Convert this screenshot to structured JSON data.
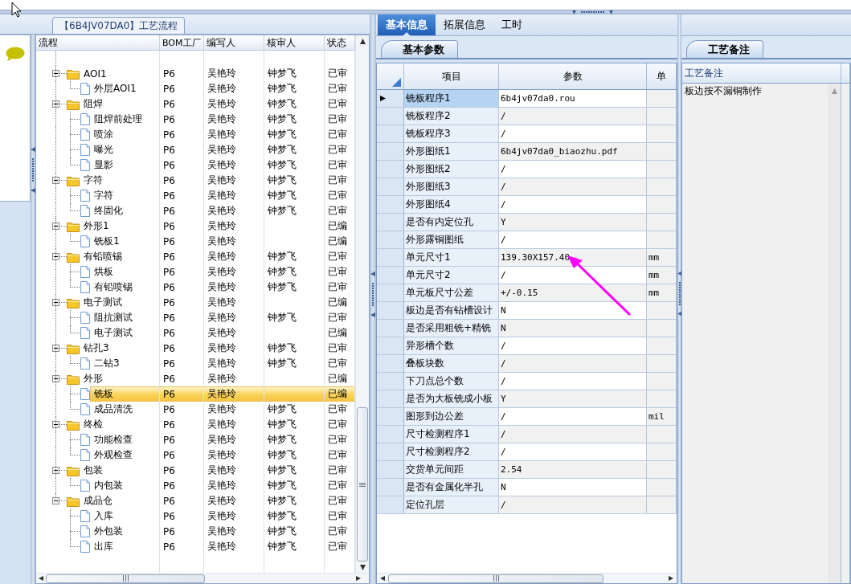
{
  "flow_panel": {
    "title": "【6B4JV07DA0】工艺流程",
    "columns": [
      "流程",
      "BOM工厂",
      "编写人",
      "核审人",
      "状态"
    ],
    "rows": [
      {
        "name": "AOI1",
        "factory": "P6",
        "writer": "吴艳玲",
        "reviewer": "钟梦飞",
        "status": "已审",
        "selected": false,
        "expanded": true,
        "children": [
          {
            "name": "外层AOI1",
            "factory": "P6",
            "writer": "吴艳玲",
            "reviewer": "钟梦飞",
            "status": "已审",
            "selected": false
          }
        ]
      },
      {
        "name": "阻焊",
        "factory": "P6",
        "writer": "吴艳玲",
        "reviewer": "钟梦飞",
        "status": "已审",
        "selected": false,
        "expanded": true,
        "children": [
          {
            "name": "阻焊前处理",
            "factory": "P6",
            "writer": "吴艳玲",
            "reviewer": "钟梦飞",
            "status": "已审",
            "selected": false
          },
          {
            "name": "喷涂",
            "factory": "P6",
            "writer": "吴艳玲",
            "reviewer": "钟梦飞",
            "status": "已审",
            "selected": false
          },
          {
            "name": "曝光",
            "factory": "P6",
            "writer": "吴艳玲",
            "reviewer": "钟梦飞",
            "status": "已审",
            "selected": false
          },
          {
            "name": "显影",
            "factory": "P6",
            "writer": "吴艳玲",
            "reviewer": "钟梦飞",
            "status": "已审",
            "selected": false
          }
        ]
      },
      {
        "name": "字符",
        "factory": "P6",
        "writer": "吴艳玲",
        "reviewer": "钟梦飞",
        "status": "已审",
        "selected": false,
        "expanded": true,
        "children": [
          {
            "name": "字符",
            "factory": "P6",
            "writer": "吴艳玲",
            "reviewer": "钟梦飞",
            "status": "已审",
            "selected": false
          },
          {
            "name": "终固化",
            "factory": "P6",
            "writer": "吴艳玲",
            "reviewer": "钟梦飞",
            "status": "已审",
            "selected": false
          }
        ]
      },
      {
        "name": "外形1",
        "factory": "P6",
        "writer": "吴艳玲",
        "status": "已编",
        "selected": false,
        "expanded": true,
        "children": [
          {
            "name": "铣板1",
            "factory": "P6",
            "writer": "吴艳玲",
            "status": "已编",
            "selected": false
          }
        ]
      },
      {
        "name": "有铅喷锡",
        "factory": "P6",
        "writer": "吴艳玲",
        "reviewer": "钟梦飞",
        "status": "已审",
        "selected": false,
        "expanded": true,
        "children": [
          {
            "name": "烘板",
            "factory": "P6",
            "writer": "吴艳玲",
            "reviewer": "钟梦飞",
            "status": "已审",
            "selected": false
          },
          {
            "name": "有铅喷锡",
            "factory": "P6",
            "writer": "吴艳玲",
            "reviewer": "钟梦飞",
            "status": "已审",
            "selected": false
          }
        ]
      },
      {
        "name": "电子测试",
        "factory": "P6",
        "writer": "吴艳玲",
        "status": "已编",
        "selected": false,
        "expanded": true,
        "children": [
          {
            "name": "阻抗测试",
            "factory": "P6",
            "writer": "吴艳玲",
            "reviewer": "钟梦飞",
            "status": "已审",
            "selected": false
          },
          {
            "name": "电子测试",
            "factory": "P6",
            "writer": "吴艳玲",
            "status": "已编",
            "selected": false
          }
        ]
      },
      {
        "name": "钻孔3",
        "factory": "P6",
        "writer": "吴艳玲",
        "reviewer": "钟梦飞",
        "status": "已审",
        "selected": false,
        "expanded": true,
        "children": [
          {
            "name": "二钻3",
            "factory": "P6",
            "writer": "吴艳玲",
            "reviewer": "钟梦飞",
            "status": "已审",
            "selected": false
          }
        ]
      },
      {
        "name": "外形",
        "factory": "P6",
        "writer": "吴艳玲",
        "status": "已编",
        "selected": false,
        "expanded": true,
        "children": [
          {
            "name": "铣板",
            "factory": "P6",
            "writer": "吴艳玲",
            "status": "已编",
            "selected": true
          },
          {
            "name": "成品清洗",
            "factory": "P6",
            "writer": "吴艳玲",
            "reviewer": "钟梦飞",
            "status": "已审",
            "selected": false
          }
        ]
      },
      {
        "name": "终检",
        "factory": "P6",
        "writer": "吴艳玲",
        "reviewer": "钟梦飞",
        "status": "已审",
        "selected": false,
        "expanded": true,
        "children": [
          {
            "name": "功能检查",
            "factory": "P6",
            "writer": "吴艳玲",
            "reviewer": "钟梦飞",
            "status": "已审",
            "selected": false
          },
          {
            "name": "外观检查",
            "factory": "P6",
            "writer": "吴艳玲",
            "reviewer": "钟梦飞",
            "status": "已审",
            "selected": false
          }
        ]
      },
      {
        "name": "包装",
        "factory": "P6",
        "writer": "吴艳玲",
        "reviewer": "钟梦飞",
        "status": "已审",
        "selected": false,
        "expanded": true,
        "children": [
          {
            "name": "内包装",
            "factory": "P6",
            "writer": "吴艳玲",
            "reviewer": "钟梦飞",
            "status": "已审",
            "selected": false
          }
        ]
      },
      {
        "name": "成品仓",
        "factory": "P6",
        "writer": "吴艳玲",
        "reviewer": "钟梦飞",
        "status": "已审",
        "selected": false,
        "expanded": true,
        "children": [
          {
            "name": "入库",
            "factory": "P6",
            "writer": "吴艳玲",
            "reviewer": "钟梦飞",
            "status": "已审",
            "selected": false
          },
          {
            "name": "外包装",
            "factory": "P6",
            "writer": "吴艳玲",
            "reviewer": "钟梦飞",
            "status": "已审",
            "selected": false
          },
          {
            "name": "出库",
            "factory": "P6",
            "writer": "吴艳玲",
            "reviewer": "钟梦飞",
            "status": "已审",
            "selected": false
          }
        ]
      }
    ]
  },
  "detail_panel": {
    "tabs": [
      {
        "label": "基本信息",
        "selected": true
      },
      {
        "label": "拓展信息",
        "selected": false
      },
      {
        "label": "工时",
        "selected": false
      }
    ],
    "subtab": "基本参数",
    "columns": [
      "项目",
      "参数",
      "单"
    ],
    "rows": [
      {
        "item": "铣板程序1",
        "value": "6b4jv07da0.rou",
        "selected": true
      },
      {
        "item": "铣板程序2",
        "value": "/",
        "selected": false
      },
      {
        "item": "铣板程序3",
        "value": "/",
        "selected": false
      },
      {
        "item": "外形图纸1",
        "value": "6b4jv07da0_biaozhu.pdf",
        "selected": false
      },
      {
        "item": "外形图纸2",
        "value": "/",
        "selected": false
      },
      {
        "item": "外形图纸3",
        "value": "/",
        "selected": false
      },
      {
        "item": "外形图纸4",
        "value": "/",
        "selected": false
      },
      {
        "item": "是否有内定位孔",
        "value": "Y",
        "selected": false
      },
      {
        "item": "外形露铜图纸",
        "value": "/",
        "selected": false
      },
      {
        "item": "单元尺寸1",
        "value": "139.30X157.40",
        "unit": "mm",
        "selected": false
      },
      {
        "item": "单元尺寸2",
        "value": "/",
        "unit": "mm",
        "selected": false
      },
      {
        "item": "单元板尺寸公差",
        "value": "+/-0.15",
        "unit": "mm",
        "selected": false
      },
      {
        "item": "板边是否有钻槽设计",
        "value": "N",
        "selected": false
      },
      {
        "item": "是否采用粗铣+精铣",
        "value": "N",
        "selected": false
      },
      {
        "item": "异形槽个数",
        "value": "/",
        "selected": false
      },
      {
        "item": "叠板块数",
        "value": "/",
        "selected": false
      },
      {
        "item": "下刀点总个数",
        "value": "/",
        "selected": false
      },
      {
        "item": "是否为大板铣成小板",
        "value": "Y",
        "selected": false
      },
      {
        "item": "图形到边公差",
        "value": "/",
        "unit": "mil",
        "selected": false
      },
      {
        "item": "尺寸检测程序1",
        "value": "/",
        "selected": false
      },
      {
        "item": "尺寸检测程序2",
        "value": "/",
        "selected": false
      },
      {
        "item": "交货单元间距",
        "value": "2.54",
        "selected": false
      },
      {
        "item": "是否有金属化半孔",
        "value": "N",
        "selected": false
      },
      {
        "item": "定位孔层",
        "value": "/",
        "selected": false
      }
    ]
  },
  "notes_panel": {
    "tab": "工艺备注",
    "column": "工艺备注",
    "text": "板边按不漏铜制作"
  }
}
